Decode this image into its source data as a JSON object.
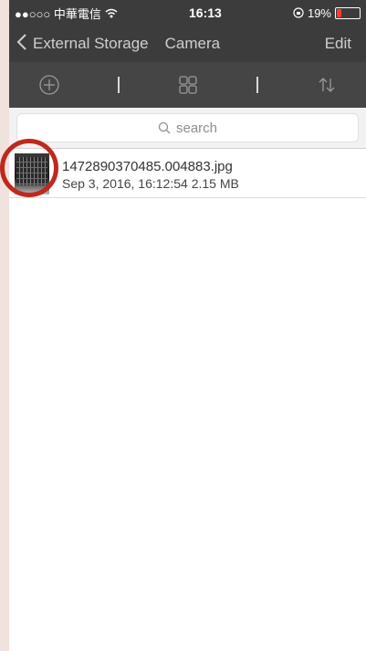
{
  "status_bar": {
    "carrier": "●●○○○ 中華電信",
    "time": "16:13",
    "battery_text": "19%",
    "battery_level": 0.19
  },
  "nav": {
    "back_label": "External Storage",
    "title": "Camera",
    "edit_label": "Edit"
  },
  "toolbar": {
    "icons": [
      "add-circle-icon",
      "grid-view-icon",
      "sort-icon"
    ]
  },
  "search": {
    "placeholder": "search"
  },
  "files": [
    {
      "name": "1472890370485.004883.jpg",
      "date": "Sep 3, 2016, 16:12:54",
      "size": "2.15 MB"
    }
  ],
  "colors": {
    "bar_bg": "#3c3c3c",
    "highlight_circle": "#c0281c",
    "battery_low": "#ff3b30"
  }
}
